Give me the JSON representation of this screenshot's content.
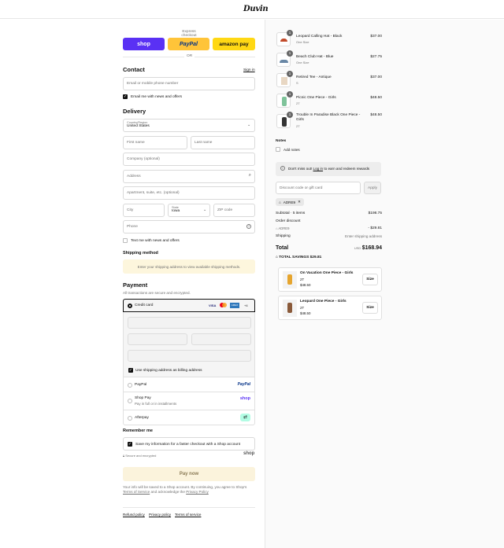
{
  "brand": {
    "logo": "Duvin"
  },
  "express": {
    "title": "Express checkout",
    "shop": "shop",
    "paypal": "PayPal",
    "amazon": "amazon pay",
    "or": "OR"
  },
  "contact": {
    "title": "Contact",
    "signin": "Sign in",
    "email_placeholder": "Email or mobile phone number",
    "news": "Email me with news and offers"
  },
  "delivery": {
    "title": "Delivery",
    "country_label": "Country/Region",
    "country_value": "United States",
    "first": "First name",
    "last": "Last name",
    "company": "Company (optional)",
    "address": "Address",
    "apt": "Apartment, suite, etc. (optional)",
    "city": "City",
    "state_label": "State",
    "state_value": "Iowa",
    "zip": "ZIP code",
    "phone": "Phone",
    "text_news": "Text me with news and offers"
  },
  "shipping": {
    "title": "Shipping method",
    "note": "Enter your shipping address to view available shipping methods."
  },
  "payment": {
    "title": "Payment",
    "subtitle": "All transactions are secure and encrypted.",
    "credit_card": "Credit card",
    "card_brands": [
      "VISA",
      "MC",
      "AMEX",
      "+4"
    ],
    "billing_same": "Use shipping address as billing address",
    "paypal": "PayPal",
    "paypal_logo": "PayPal",
    "shoppay": "Shop Pay",
    "shoppay_sub": "Pay in full or in installments",
    "shoppay_logo": "shop",
    "afterpay": "Afterpay"
  },
  "remember": {
    "title": "Remember me",
    "save": "Save my information for a faster checkout with a Shop account",
    "secure": "Secure and encrypted",
    "shop_logo": "shop"
  },
  "paynow": {
    "label": "Pay now",
    "legal_1": "Your info will be saved to a Shop account. By continuing, you agree to Shop's",
    "terms": "Terms of Service",
    "legal_2": "and acknowledge the",
    "privacy": "Privacy Policy"
  },
  "footer": {
    "refund": "Refund policy",
    "privacy": "Privacy policy",
    "terms": "Terms of service"
  },
  "cart": {
    "items": [
      {
        "name": "Leopard Calling Hat - Black",
        "variant": "One Size",
        "qty": "1",
        "price": "$37.00",
        "icon": "hat-icon",
        "color": "#c24a2a"
      },
      {
        "name": "Beach Club Hat - Blue",
        "variant": "One Size",
        "qty": "1",
        "price": "$27.75",
        "icon": "hat-icon",
        "color": "#6a88a6"
      },
      {
        "name": "Retired Tee - Antique",
        "variant": "S",
        "qty": "1",
        "price": "$37.00",
        "icon": "tee-icon",
        "color": "#e8d7c3"
      },
      {
        "name": "Picnic One Piece - Girls",
        "variant": "2T",
        "qty": "1",
        "price": "$48.50",
        "icon": "swimsuit-icon",
        "color": "#7fc39a"
      },
      {
        "name": "Trouble In Paradise Black One Piece - Girls",
        "variant": "2T",
        "qty": "1",
        "price": "$48.50",
        "icon": "swimsuit-icon",
        "color": "#333333"
      }
    ],
    "notes_title": "Notes",
    "add_notes": "Add notes",
    "rewards_pre": "Don't miss out!",
    "rewards_link": "Log in",
    "rewards_post": "to earn and redeem rewards",
    "discount_placeholder": "Discount code or gift card",
    "apply": "Apply",
    "code": "ADRE9",
    "subtotal_label": "Subtotal · 5 items",
    "subtotal": "$198.75",
    "order_discount": "Order discount",
    "discount_code": "ADRE9",
    "discount_value": "- $29.81",
    "shipping_label": "Shipping",
    "shipping_value": "Enter shipping address",
    "total_label": "Total",
    "currency": "USD",
    "total": "$168.94",
    "savings_label": "TOTAL SAVINGS",
    "savings": "$29.81"
  },
  "upsell": [
    {
      "name": "On Vacation One Piece - Girls",
      "variant": "2T",
      "price": "$48.50",
      "button": "Size",
      "color": "#e6a52e"
    },
    {
      "name": "Leopard One Piece - Girls",
      "variant": "2T",
      "price": "$48.50",
      "button": "Size",
      "color": "#8a5a3a"
    }
  ],
  "colors": {
    "accent": "#5a31f4",
    "paypal": "#ffc439",
    "amazon": "#ffd814",
    "notice": "#fdf6dd",
    "pay_button": "#fbf3dc"
  }
}
